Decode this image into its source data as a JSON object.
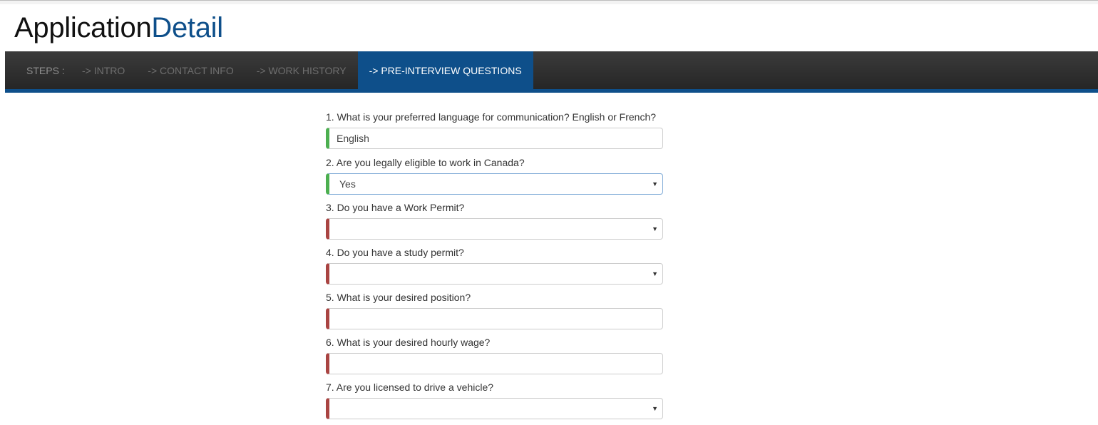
{
  "header": {
    "title_part1": "Application",
    "title_part2": "Detail"
  },
  "steps": {
    "label": "STEPS :",
    "items": [
      {
        "label": "-> INTRO",
        "active": false
      },
      {
        "label": "-> CONTACT INFO",
        "active": false
      },
      {
        "label": "-> WORK HISTORY",
        "active": false
      },
      {
        "label": "-> PRE-INTERVIEW QUESTIONS",
        "active": true
      }
    ]
  },
  "colors": {
    "accent": "#0e4f8a",
    "valid": "#4caf50",
    "invalid": "#a94442"
  },
  "form": {
    "questions": [
      {
        "label": "1. What is your preferred language for communication? English or French?",
        "type": "input",
        "value": "English",
        "state": "valid"
      },
      {
        "label": "2. Are you legally eligible to work in Canada?",
        "type": "select",
        "value": "Yes",
        "state": "valid"
      },
      {
        "label": "3. Do you have a Work Permit?",
        "type": "select",
        "value": "",
        "state": "invalid"
      },
      {
        "label": "4. Do you have a study permit?",
        "type": "select",
        "value": "",
        "state": "invalid"
      },
      {
        "label": "5. What is your desired position?",
        "type": "input",
        "value": "",
        "state": "invalid"
      },
      {
        "label": "6. What is your desired hourly wage?",
        "type": "input",
        "value": "",
        "state": "invalid"
      },
      {
        "label": "7. Are you licensed to drive a vehicle?",
        "type": "select",
        "value": "",
        "state": "invalid"
      }
    ]
  },
  "icons": {
    "dropdown_caret": "▼"
  }
}
